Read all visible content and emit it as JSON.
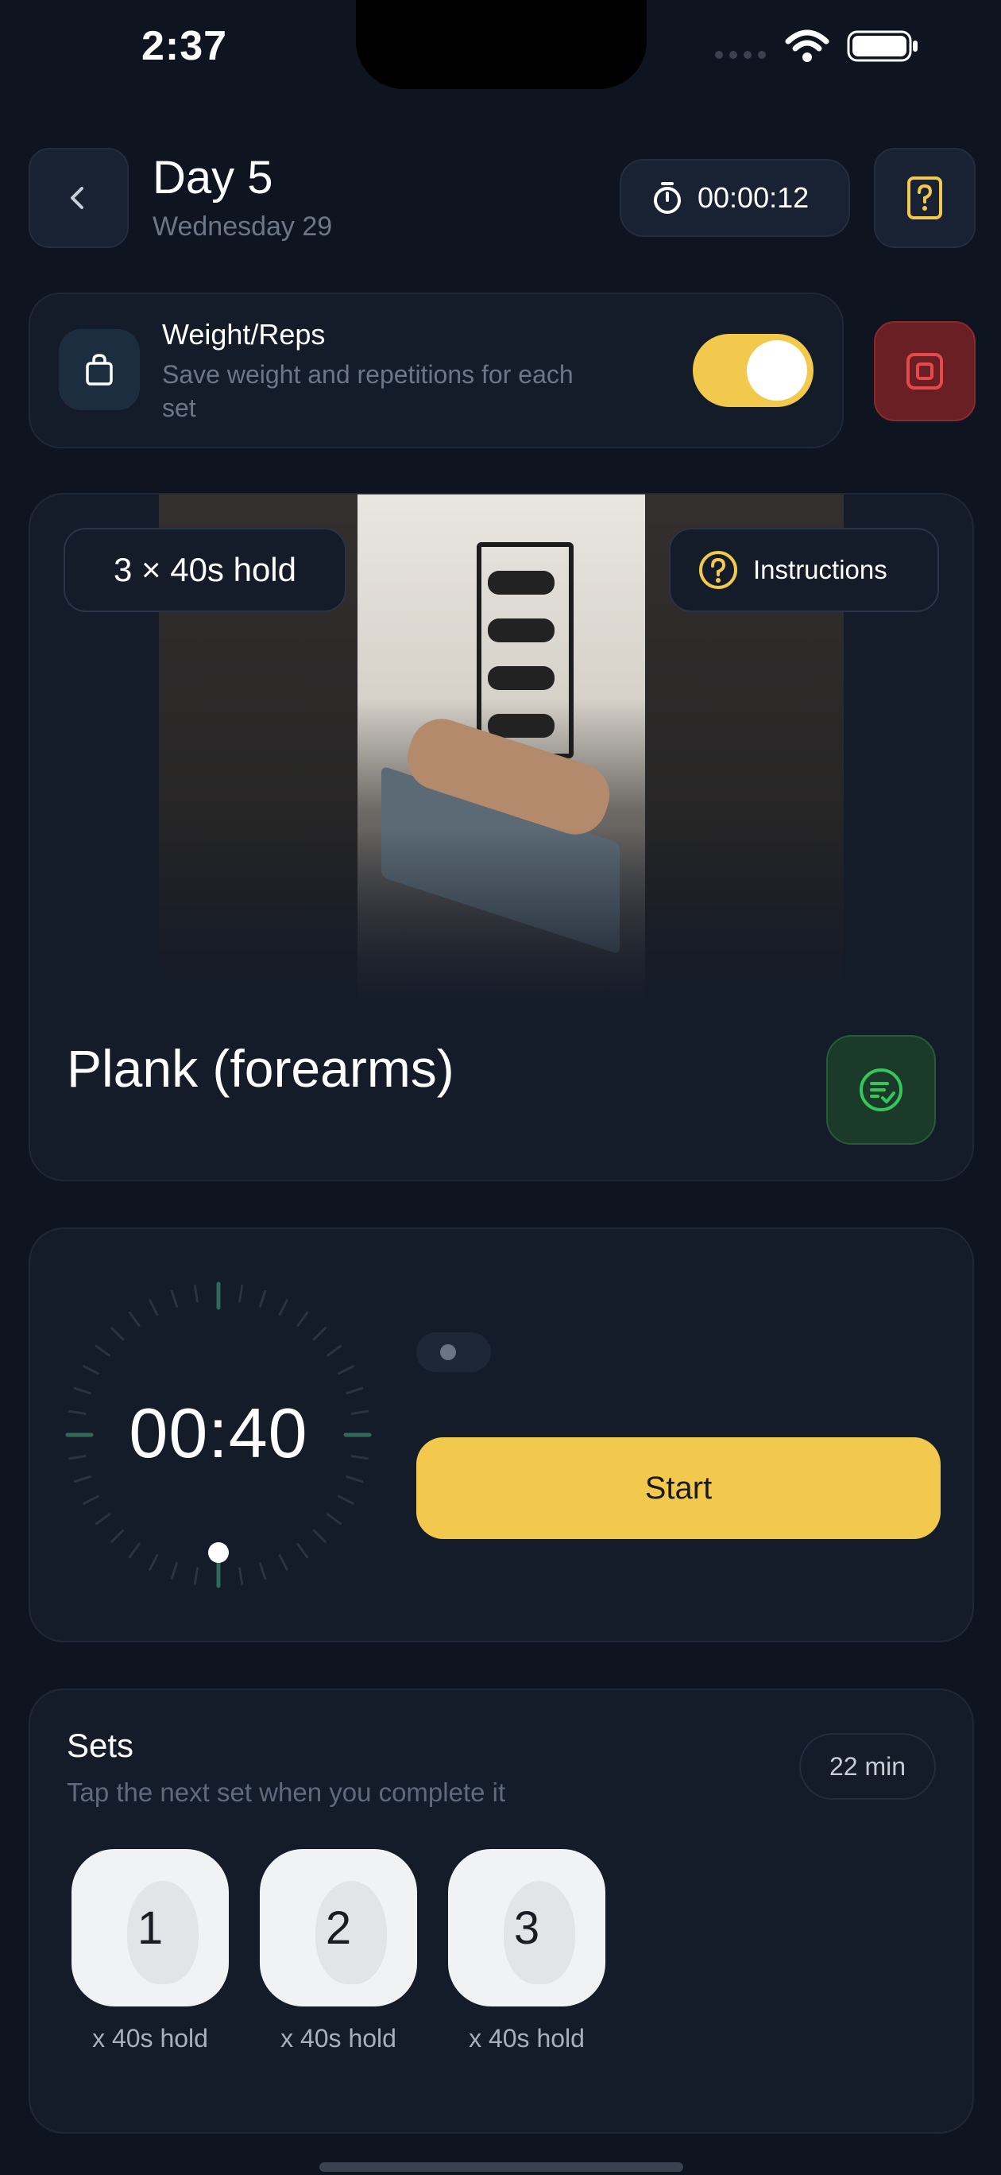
{
  "status_bar": {
    "time": "2:37"
  },
  "header": {
    "title": "Day 5",
    "subtitle": "Wednesday 29",
    "elapsed": "00:00:12"
  },
  "weight_reps": {
    "title": "Weight/Reps",
    "description": "Save weight and repetitions for each set",
    "enabled": true
  },
  "exercise": {
    "target_pill": "3 × 40s hold",
    "instructions_label": "Instructions",
    "name": "Plank (forearms)"
  },
  "timer": {
    "display": "00:40",
    "start_label": "Start"
  },
  "sets": {
    "title": "Sets",
    "description": "Tap the next set when you complete it",
    "duration_badge": "22 min",
    "items": [
      {
        "number": "1",
        "label": "x 40s hold"
      },
      {
        "number": "2",
        "label": "x 40s hold"
      },
      {
        "number": "3",
        "label": "x 40s hold"
      }
    ]
  },
  "colors": {
    "background": "#0f1520",
    "card": "#141c2a",
    "accent_yellow": "#f2c94c",
    "stop_red": "#d9363e",
    "complete_green": "#35c759"
  },
  "icons": [
    "back-icon",
    "stopwatch-icon",
    "question-doc-icon",
    "bag-icon",
    "stop-icon",
    "question-circle-icon",
    "checklist-icon",
    "wifi-icon",
    "battery-icon",
    "flame-icon"
  ]
}
